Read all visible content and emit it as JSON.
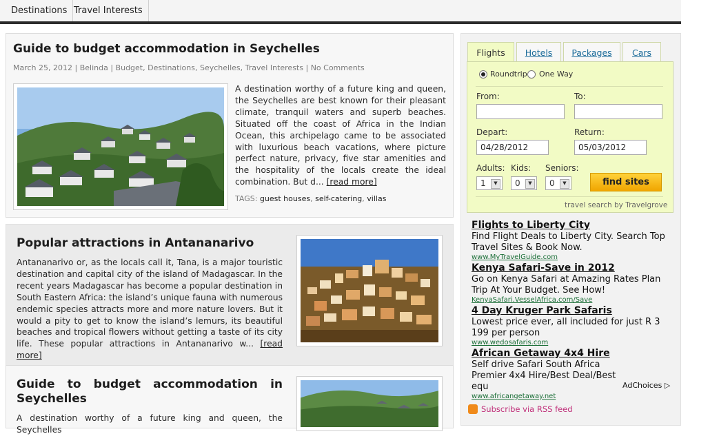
{
  "nav": {
    "items": [
      "Destinations",
      "Travel Interests"
    ]
  },
  "posts": [
    {
      "title": "Guide to budget accommodation in Seychelles",
      "meta": {
        "date": "March 25, 2012",
        "author": "Belinda",
        "categories": [
          "Budget",
          "Destinations",
          "Seychelles",
          "Travel Interests"
        ],
        "comments": "No Comments"
      },
      "excerpt": "A destination worthy of a future king and queen, the Seychelles are best known for their pleasant climate, tranquil waters and superb beaches. Situated off the coast of Africa in the Indian Ocean, this archipelago came to be associated with luxurious beach vacations, where picture perfect nature, privacy, five star amenities and the hospitality of the locals create the ideal combination. But d...",
      "read_more": "[read more]",
      "tags_label": "TAGS:",
      "tags": [
        "guest houses",
        "self-catering",
        "villas"
      ]
    },
    {
      "title": "Popular attractions in Antananarivo",
      "excerpt": "Antananarivo or, as the locals call it, Tana, is a major touristic destination and capital city of the island of Madagascar. In the recent years Madagascar has become a popular destination in South Eastern Africa: the island’s unique fauna with numerous endemic species attracts more and more nature lovers. But it would a pity to get to know the island’s lemurs, its beautiful beaches and tropical flowers without getting a taste of its city life. These popular attractions in Antananarivo w...",
      "read_more": "[read more]"
    },
    {
      "title": "Guide to budget accommodation in Seychelles",
      "excerpt": "A destination worthy of a future king and queen, the Seychelles"
    }
  ],
  "search_widget": {
    "tabs": [
      "Flights",
      "Hotels",
      "Packages",
      "Cars"
    ],
    "trip_types": [
      "Roundtrip",
      "One Way"
    ],
    "from_label": "From:",
    "to_label": "To:",
    "from_value": "",
    "to_value": "",
    "depart_label": "Depart:",
    "return_label": "Return:",
    "depart_value": "04/28/2012",
    "return_value": "05/03/2012",
    "adults_label": "Adults:",
    "kids_label": "Kids:",
    "seniors_label": "Seniors:",
    "adults_value": "1",
    "kids_value": "0",
    "seniors_value": "0",
    "find_button": "find sites",
    "powered_by": "travel search by Travelgrove"
  },
  "ads": [
    {
      "title": "Flights to Liberty City",
      "text": "Find Flight Deals to Liberty City. Search Top Travel Sites & Book Now.",
      "url": "www.MyTravelGuide.com"
    },
    {
      "title": "Kenya Safari-Save in 2012",
      "text": "Go on Kenya Safari at Amazing Rates Plan Trip At Your Budget. See How!",
      "url": "KenyaSafari.VesselAfrica.com/Save"
    },
    {
      "title": "4 Day Kruger Park Safaris",
      "text": "Lowest price ever, all included for just R 3 199 per person",
      "url": "www.wedosafaris.com"
    },
    {
      "title": "African Getaway 4x4 Hire",
      "text": "Self drive Safari South Africa Premier 4x4 Hire/Best Deal/Best equ",
      "url": "www.africangetaway.net"
    }
  ],
  "adchoices": "AdChoices",
  "rss": "Subscribe via RSS feed"
}
